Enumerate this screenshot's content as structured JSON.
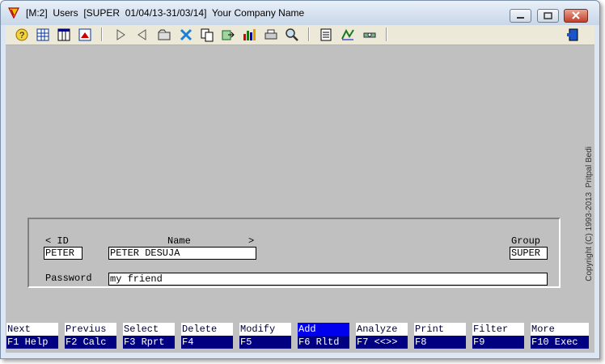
{
  "window": {
    "title": "[M:2]  Users  [SUPER  01/04/13-31/03/14]  Your Company Name"
  },
  "toolbar": {
    "icons": [
      "help-icon",
      "grid-icon",
      "table-icon",
      "report-icon",
      "play-icon",
      "back-icon",
      "folder-icon",
      "tools-icon",
      "copy-icon",
      "export-icon",
      "chart-icon",
      "print-icon",
      "search-icon",
      "clipboard-icon",
      "calc-icon",
      "settings-icon",
      "exit-icon"
    ]
  },
  "form": {
    "id_label": "< ID",
    "name_label": "Name",
    "more_marker": ">",
    "group_label": "Group",
    "password_label": "Password",
    "id_value": "PETER",
    "name_value": "PETER DESUJA",
    "group_value": "SUPER",
    "password_value": "my friend"
  },
  "copyright": "Copyright (C) 1993-2013  Pritpal Bedi",
  "fkeys": [
    {
      "action": "Next",
      "key": "F1 Help"
    },
    {
      "action": "Previus",
      "key": "F2 Calc"
    },
    {
      "action": "Select",
      "key": "F3 Rprt"
    },
    {
      "action": "Delete",
      "key": "F4"
    },
    {
      "action": "Modify",
      "key": "F5"
    },
    {
      "action": "Add",
      "key": "F6 Rltd"
    },
    {
      "action": "Analyze",
      "key": "F7 <<>>"
    },
    {
      "action": "Print",
      "key": "F8"
    },
    {
      "action": "Filter",
      "key": "F9"
    },
    {
      "action": "More",
      "key": "F10 Exec"
    }
  ],
  "colors": {
    "active_key": "#0000ee",
    "key_bar": "#000080",
    "client_bg": "#c0c0c0"
  }
}
